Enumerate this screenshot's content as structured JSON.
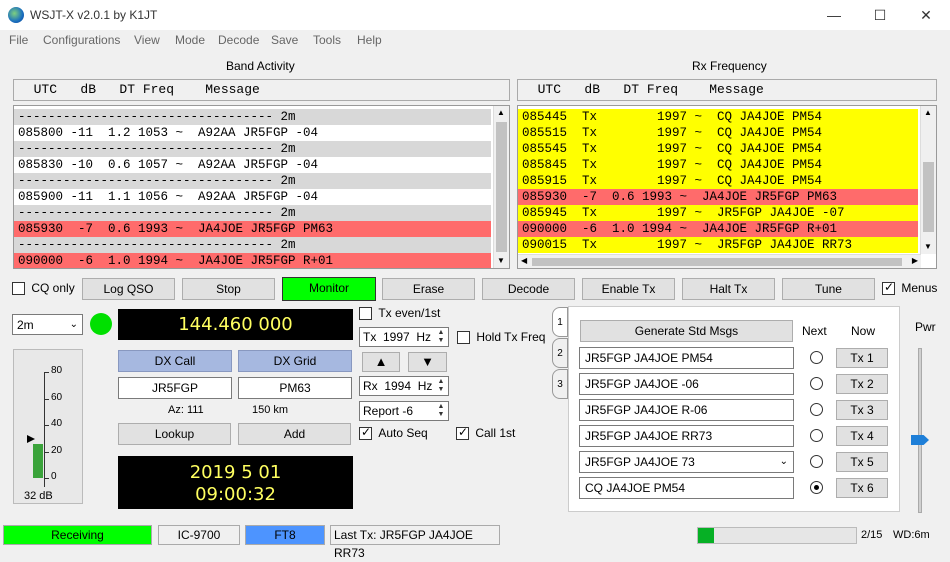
{
  "window": {
    "title": "WSJT-X   v2.0.1   by K1JT"
  },
  "menu": [
    "File",
    "Configurations",
    "View",
    "Mode",
    "Decode",
    "Save",
    "Tools",
    "Help"
  ],
  "band_activity": {
    "title": "Band Activity",
    "header": "  UTC   dB   DT Freq    Message",
    "rows": [
      {
        "text": "---------------------------------- 2m",
        "style": "sep"
      },
      {
        "text": "085800 -11  1.2 1053 ~  A92AA JR5FGP -04",
        "style": "white"
      },
      {
        "text": "---------------------------------- 2m",
        "style": "sep"
      },
      {
        "text": "085830 -10  0.6 1057 ~  A92AA JR5FGP -04",
        "style": "white"
      },
      {
        "text": "---------------------------------- 2m",
        "style": "sep"
      },
      {
        "text": "085900 -11  1.1 1056 ~  A92AA JR5FGP -04",
        "style": "white"
      },
      {
        "text": "---------------------------------- 2m",
        "style": "sep"
      },
      {
        "text": "085930  -7  0.6 1993 ~  JA4JOE JR5FGP PM63",
        "style": "red"
      },
      {
        "text": "---------------------------------- 2m",
        "style": "sep"
      },
      {
        "text": "090000  -6  1.0 1994 ~  JA4JOE JR5FGP R+01",
        "style": "red"
      }
    ]
  },
  "rx_frequency": {
    "title": "Rx Frequency",
    "header": "  UTC   dB   DT Freq    Message",
    "rows": [
      {
        "text": "085445  Tx        1997 ~  CQ JA4JOE PM54",
        "style": "yel"
      },
      {
        "text": "085515  Tx        1997 ~  CQ JA4JOE PM54",
        "style": "yel"
      },
      {
        "text": "085545  Tx        1997 ~  CQ JA4JOE PM54",
        "style": "yel"
      },
      {
        "text": "085845  Tx        1997 ~  CQ JA4JOE PM54",
        "style": "yel"
      },
      {
        "text": "085915  Tx        1997 ~  CQ JA4JOE PM54",
        "style": "yel"
      },
      {
        "text": "085930  -7  0.6 1993 ~  JA4JOE JR5FGP PM63",
        "style": "red"
      },
      {
        "text": "085945  Tx        1997 ~  JR5FGP JA4JOE -07",
        "style": "yel"
      },
      {
        "text": "090000  -6  1.0 1994 ~  JA4JOE JR5FGP R+01",
        "style": "red"
      },
      {
        "text": "090015  Tx        1997 ~  JR5FGP JA4JOE RR73",
        "style": "yel"
      }
    ]
  },
  "controls": {
    "cq_only": "CQ only",
    "log_qso": "Log QSO",
    "stop": "Stop",
    "monitor": "Monitor",
    "erase": "Erase",
    "decode": "Decode",
    "enable_tx": "Enable Tx",
    "halt_tx": "Halt Tx",
    "tune": "Tune",
    "menus": "Menus"
  },
  "band": "2m",
  "frequency": "144.460 000",
  "dx": {
    "call_label": "DX Call",
    "grid_label": "DX Grid",
    "call": "JR5FGP",
    "grid": "PM63",
    "az": "Az: 111",
    "dist": "150 km",
    "lookup": "Lookup",
    "add": "Add"
  },
  "meter": {
    "ticks": [
      "80",
      "60",
      "40",
      "20",
      "0"
    ],
    "db": "32 dB",
    "level_pct": 32
  },
  "clock": {
    "date": "2019 5 01",
    "time": "09:00:32"
  },
  "tx_options": {
    "tx_even": "Tx even/1st",
    "tx_hz": "Tx  1997  Hz",
    "hold_tx": "Hold Tx Freq",
    "rx_hz": "Rx  1994  Hz",
    "report": "Report -6",
    "auto_seq": "Auto Seq",
    "call_1st": "Call 1st"
  },
  "tabs": [
    "1",
    "2",
    "3"
  ],
  "messages": {
    "generate": "Generate Std Msgs",
    "next": "Next",
    "now": "Now",
    "items": [
      {
        "text": "JR5FGP JA4JOE PM54",
        "btn": "Tx 1",
        "selected": false
      },
      {
        "text": "JR5FGP JA4JOE -06",
        "btn": "Tx 2",
        "selected": false
      },
      {
        "text": "JR5FGP JA4JOE R-06",
        "btn": "Tx 3",
        "selected": false
      },
      {
        "text": "JR5FGP JA4JOE RR73",
        "btn": "Tx 4",
        "selected": false
      },
      {
        "text": "JR5FGP JA4JOE 73",
        "btn": "Tx 5",
        "selected": false
      },
      {
        "text": "CQ JA4JOE PM54",
        "btn": "Tx 6",
        "selected": true
      }
    ]
  },
  "pwr": {
    "label": "Pwr"
  },
  "statusbar": {
    "state": "Receiving",
    "rig": "IC-9700",
    "mode": "FT8",
    "last_tx": "Last Tx: JR5FGP JA4JOE RR73",
    "progress_frac": 0.1,
    "count": "2/15",
    "wd": "WD:6m"
  },
  "colors": {
    "green": "#00ff00",
    "red": "#ff6b6b",
    "yellow": "#ffff00",
    "blue": "#4d94ff"
  }
}
